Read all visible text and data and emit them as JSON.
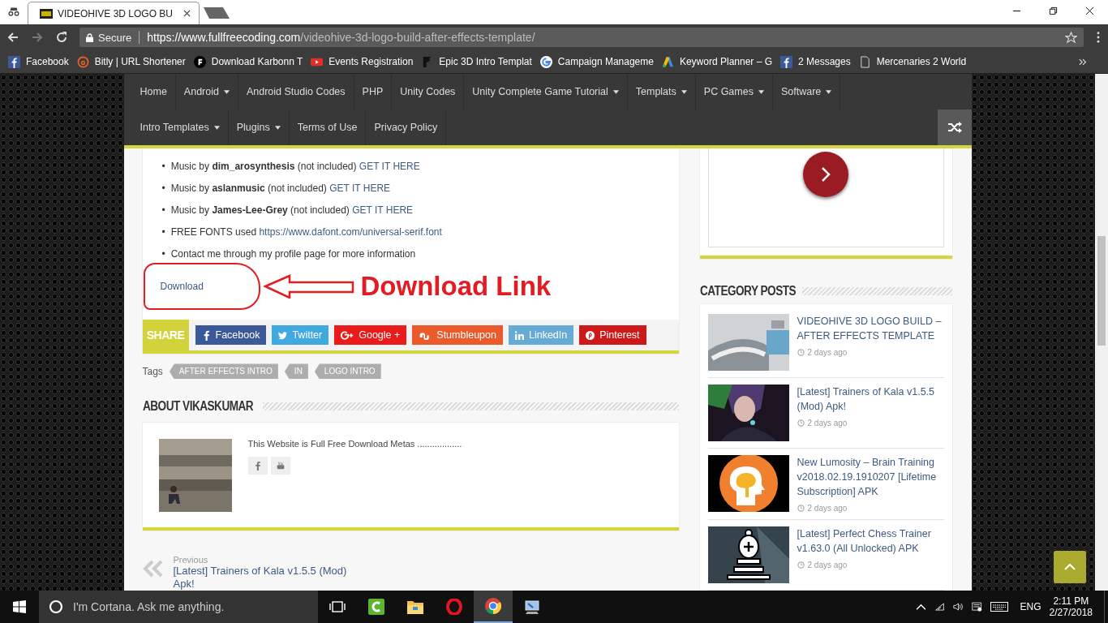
{
  "browser": {
    "tab_title": "VIDEOHIVE 3D LOGO BU",
    "secure_label": "Secure",
    "url_host": "https://www.fullfreecoding.com",
    "url_path": "/videohive-3d-logo-build-after-effects-template/",
    "bookmarks": [
      {
        "label": "Facebook",
        "kind": "facebook"
      },
      {
        "label": "Bitly | URL Shortener",
        "kind": "bitly"
      },
      {
        "label": "Download Karbonn T",
        "kind": "circle-f"
      },
      {
        "label": "Events Registration",
        "kind": "youtube"
      },
      {
        "label": "Epic 3D Intro Templat",
        "kind": "epic"
      },
      {
        "label": "Campaign Manageme",
        "kind": "google"
      },
      {
        "label": "Keyword Planner – G",
        "kind": "adwords"
      },
      {
        "label": "2 Messages",
        "kind": "facebook"
      },
      {
        "label": "Mercenaries 2 World",
        "kind": "page"
      }
    ]
  },
  "nav": {
    "items": [
      {
        "label": "Home",
        "dropdown": false
      },
      {
        "label": "Android",
        "dropdown": true
      },
      {
        "label": "Android Studio Codes",
        "dropdown": false
      },
      {
        "label": "PHP",
        "dropdown": false
      },
      {
        "label": "Unity Codes",
        "dropdown": false
      },
      {
        "label": "Unity Complete Game Tutorial",
        "dropdown": true
      },
      {
        "label": "Templats",
        "dropdown": true
      },
      {
        "label": "PC Games",
        "dropdown": true
      },
      {
        "label": "Software",
        "dropdown": true
      },
      {
        "label": "Intro Templates",
        "dropdown": true
      },
      {
        "label": "Plugins",
        "dropdown": true
      },
      {
        "label": "Terms of Use",
        "dropdown": false
      },
      {
        "label": "Privacy Policy",
        "dropdown": false
      }
    ]
  },
  "article": {
    "bullet": "•",
    "list": [
      {
        "text": "Music by **dim_arosynthesis** (not included)",
        "link": "GET IT HERE"
      },
      {
        "text": "Music by **aslanmusic** (not included)",
        "link": "GET IT HERE"
      },
      {
        "text": "Music by **James-Lee-Grey** (not included)",
        "link": "GET IT HERE"
      },
      {
        "text": "FREE FONTS used",
        "link": "https://www.dafont.com/universal-serif.font"
      },
      {
        "text": "Contact me through my profile page for more information"
      }
    ],
    "download_link": "Download",
    "annotation": "Download Link"
  },
  "share": {
    "label": "SHARE",
    "buttons": [
      {
        "label": "Facebook",
        "kind": "facebook",
        "color": "#3b5998"
      },
      {
        "label": "Twitter",
        "kind": "twitter",
        "color": "#40a9e0"
      },
      {
        "label": "Google +",
        "kind": "google-plus",
        "color": "#e91b1b"
      },
      {
        "label": "Stumbleupon",
        "kind": "stumbleupon",
        "color": "#eb5a2a"
      },
      {
        "label": "LinkedIn",
        "kind": "linkedin",
        "color": "#65abd6"
      },
      {
        "label": "Pinterest",
        "kind": "pinterest",
        "color": "#cc1a1a"
      }
    ]
  },
  "tags": {
    "label": "Tags",
    "items": [
      "AFTER EFFECTS INTRO",
      "IN",
      "LOGO INTRO"
    ]
  },
  "about": {
    "heading": "ABOUT VIKASKUMAR",
    "bio": "This Website is Full Free Download Metas ..................",
    "social": [
      {
        "kind": "facebook"
      },
      {
        "kind": "youtube"
      }
    ]
  },
  "post_nav": {
    "label": "Previous",
    "title": "[Latest] Trainers of Kala v1.5.5 (Mod) Apk!"
  },
  "sidebar": {
    "heading": "CATEGORY POSTS",
    "posts": [
      {
        "title": "VIDEOHIVE 3D LOGO BUILD – AFTER EFFECTS TEMPLATE",
        "time": "2 days ago",
        "kind": "logo"
      },
      {
        "title": "[Latest] Trainers of Kala v1.5.5 (Mod) Apk!",
        "time": "2 days ago",
        "kind": "character"
      },
      {
        "title": "New Lumosity – Brain Training v2018.02.19.1910207 [Lifetime Subscription] APK",
        "time": "2 days ago",
        "kind": "head"
      },
      {
        "title": "[Latest] Perfect Chess Trainer v1.63.0 (All Unlocked) APK",
        "time": "2 days ago",
        "kind": "chess"
      }
    ]
  },
  "taskbar": {
    "search_placeholder": "I'm Cortana. Ask me anything.",
    "apps": [
      {
        "kind": "task-view",
        "selected": false
      },
      {
        "kind": "camtasia",
        "selected": false
      },
      {
        "kind": "folder",
        "selected": false
      },
      {
        "kind": "opera",
        "selected": false
      },
      {
        "kind": "chrome",
        "selected": true
      },
      {
        "kind": "monitor",
        "selected": false
      }
    ],
    "language": "ENG",
    "time": "2:11 PM",
    "date": "2/27/2018"
  }
}
